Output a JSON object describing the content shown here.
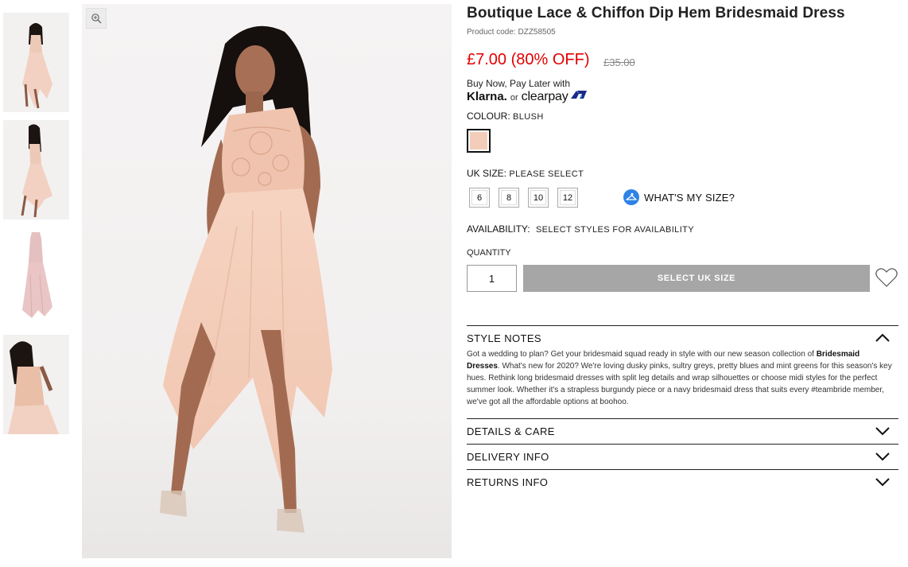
{
  "product": {
    "title": "Boutique Lace & Chiffon Dip Hem Bridesmaid Dress",
    "code": "Product code: DZZ58505",
    "price": "£7.00 (80% OFF)",
    "was_price": "£35.00",
    "price_color": "#e20000"
  },
  "payments": {
    "pay_later_text": "Buy Now, Pay Later with",
    "klarna": "Klarna.",
    "or": "or",
    "clearpay": "clearpay"
  },
  "colour": {
    "label": "COLOUR:",
    "value": "BLUSH",
    "swatch_color": "#f3cdb9"
  },
  "size": {
    "label": "UK SIZE:",
    "value": "PLEASE SELECT",
    "options": [
      "6",
      "8",
      "10",
      "12"
    ],
    "whats_my_size": "WHAT'S MY SIZE?"
  },
  "availability": {
    "label": "AVAILABILITY:",
    "value": "SELECT STYLES FOR AVAILABILITY"
  },
  "quantity": {
    "label": "QUANTITY",
    "value": "1"
  },
  "actions": {
    "add_button": "SELECT UK SIZE",
    "button_color": "#a6a6a6"
  },
  "sections": {
    "style_notes": {
      "title": "STYLE NOTES",
      "text_before": "Got a wedding to plan? Get your bridesmaid squad ready in style with our new season collection of ",
      "link": "Bridesmaid Dresses",
      "text_after": ". What's new for 2020? We're loving dusky pinks, sultry greys, pretty blues and mint greens for this season's key hues. Rethink long bridesmaid dresses with split leg details and wrap silhouettes or choose midi styles for the perfect summer look. Whether it's a strapless burgundy piece or a navy bridesmaid dress that suits every #teambride member, we've got all the affordable options at boohoo."
    },
    "details": {
      "title": "DETAILS & CARE"
    },
    "delivery": {
      "title": "DELIVERY INFO"
    },
    "returns": {
      "title": "RETURNS INFO"
    }
  },
  "gallery": {
    "thumbnail_icons": [
      "dress-front-thumbnail",
      "dress-back-thumbnail",
      "dress-flat-thumbnail",
      "dress-side-thumbnail"
    ],
    "zoom_icon": "zoom-in-icon"
  }
}
